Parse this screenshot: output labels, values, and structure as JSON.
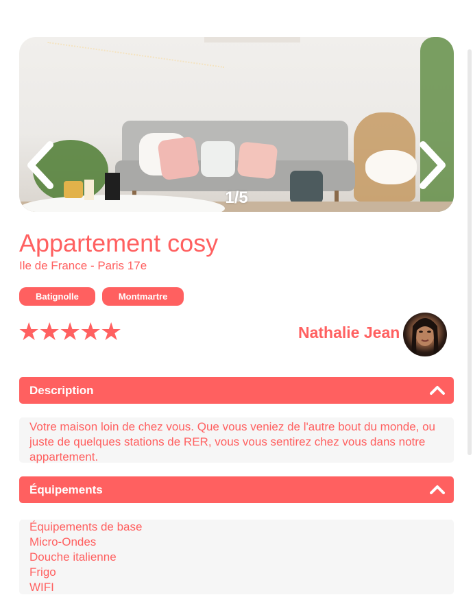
{
  "carousel": {
    "counter": "1/5",
    "prev_icon": "chevron-left-icon",
    "next_icon": "chevron-right-icon"
  },
  "listing": {
    "title": "Appartement cosy",
    "location": "Ile de France - Paris 17e",
    "tags": [
      "Batignolle",
      "Montmartre"
    ],
    "rating": {
      "value": 5,
      "max": 5
    }
  },
  "host": {
    "name": "Nathalie Jean"
  },
  "description": {
    "header": "Description",
    "text": "Votre maison loin de chez vous. Que vous veniez de l'autre bout du monde, ou juste de quelques stations de RER, vous vous sentirez chez vous dans notre appartement.",
    "toggle_icon": "chevron-up-icon"
  },
  "equipment": {
    "header": "Équipements",
    "items": [
      "Équipements de base",
      "Micro-Ondes",
      "Douche italienne",
      "Frigo",
      "WIFI"
    ],
    "toggle_icon": "chevron-up-icon"
  },
  "colors": {
    "accent": "#ff6060",
    "panel_bg": "#f6f6f6"
  }
}
